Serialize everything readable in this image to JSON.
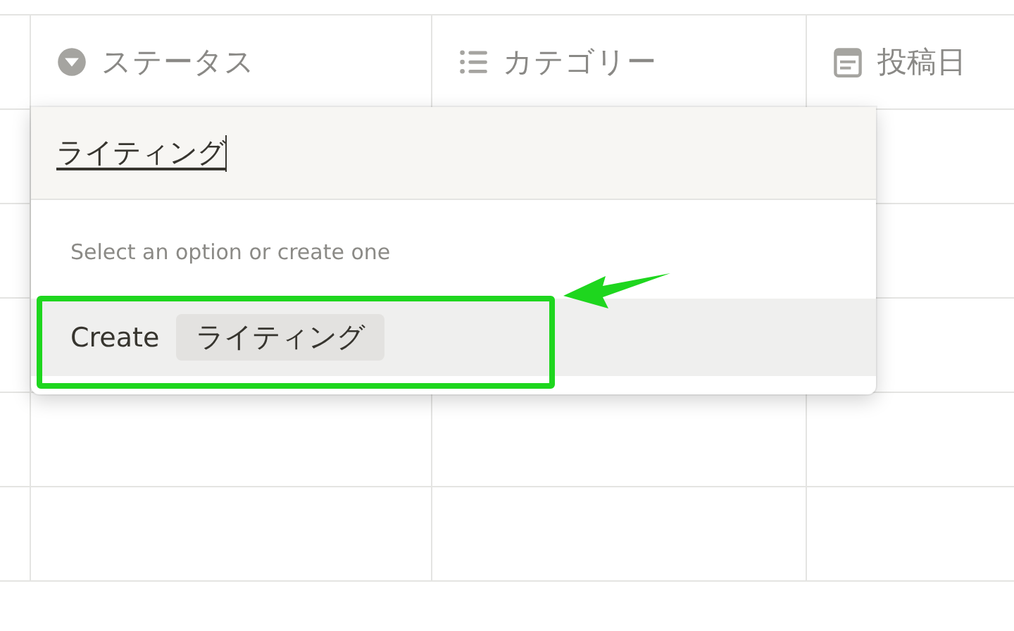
{
  "table": {
    "columns": [
      {
        "label": "ステータス",
        "kind": "select"
      },
      {
        "label": "カテゴリー",
        "kind": "multi_select"
      },
      {
        "label": "投稿日",
        "kind": "date"
      }
    ]
  },
  "dropdown": {
    "value": "ライティング",
    "hint": "Select an option or create one",
    "option": {
      "action": "Create",
      "tag": "ライティング",
      "selected": true,
      "highlighted": true
    },
    "pointer_arrow": true
  }
}
